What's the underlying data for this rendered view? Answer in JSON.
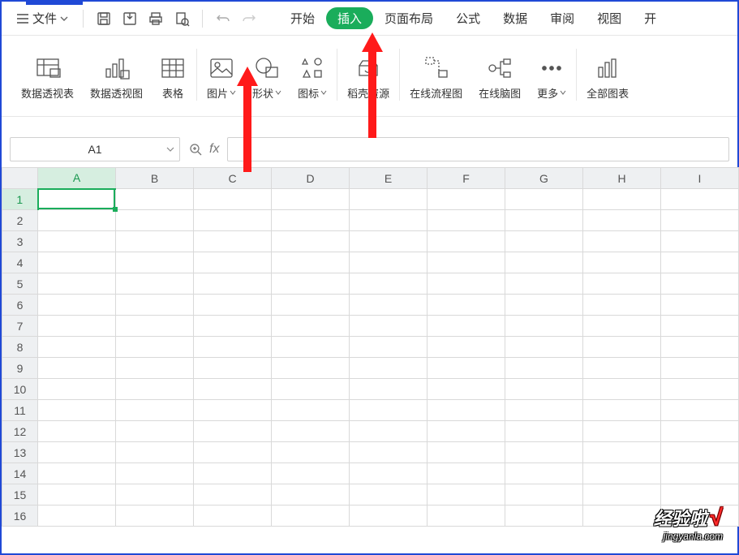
{
  "file_menu": {
    "label": "文件"
  },
  "tabs": {
    "start": "开始",
    "insert": "插入",
    "layout": "页面布局",
    "formula": "公式",
    "data": "数据",
    "review": "审阅",
    "view": "视图",
    "more_right": "开"
  },
  "ribbon": {
    "pivot_table": "数据透视表",
    "pivot_chart": "数据透视图",
    "table": "表格",
    "picture": "图片",
    "shape": "形状",
    "icon": "图标",
    "doker": "稻壳资源",
    "flowchart": "在线流程图",
    "mindmap": "在线脑图",
    "more": "更多",
    "all_charts": "全部图表"
  },
  "name_box": {
    "value": "A1"
  },
  "fx": {
    "label": "fx"
  },
  "columns": [
    "A",
    "B",
    "C",
    "D",
    "E",
    "F",
    "G",
    "H",
    "I"
  ],
  "rows": [
    "1",
    "2",
    "3",
    "4",
    "5",
    "6",
    "7",
    "8",
    "9",
    "10",
    "11",
    "12",
    "13",
    "14",
    "15",
    "16"
  ],
  "selected": {
    "col": "A",
    "row": "1"
  },
  "watermark": {
    "brand": "经验啦",
    "check": "√",
    "url": "jingyanla.com"
  }
}
